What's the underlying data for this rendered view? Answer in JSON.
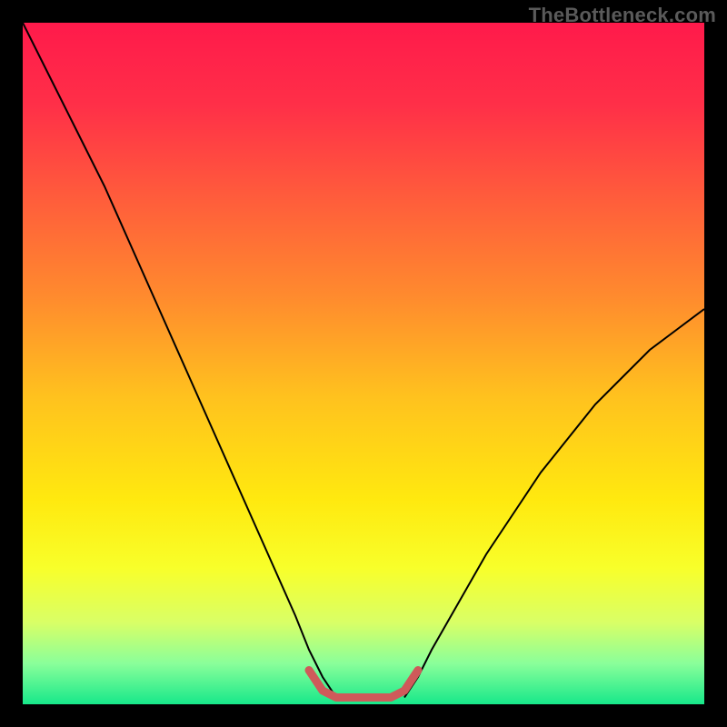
{
  "watermark": "TheBottleneck.com",
  "chart_data": {
    "type": "line",
    "title": "",
    "xlabel": "",
    "ylabel": "",
    "xlim": [
      0,
      100
    ],
    "ylim": [
      0,
      100
    ],
    "grid": false,
    "legend": false,
    "gradient_stops": [
      {
        "offset": 0.0,
        "color": "#ff1a4b"
      },
      {
        "offset": 0.12,
        "color": "#ff2f48"
      },
      {
        "offset": 0.25,
        "color": "#ff5a3c"
      },
      {
        "offset": 0.4,
        "color": "#ff8a2e"
      },
      {
        "offset": 0.55,
        "color": "#ffc21e"
      },
      {
        "offset": 0.7,
        "color": "#ffe90f"
      },
      {
        "offset": 0.8,
        "color": "#f8ff2a"
      },
      {
        "offset": 0.88,
        "color": "#d9ff66"
      },
      {
        "offset": 0.94,
        "color": "#8aff9a"
      },
      {
        "offset": 1.0,
        "color": "#17e88a"
      }
    ],
    "series": [
      {
        "name": "left-curve",
        "stroke": "#000000",
        "stroke_width": 2,
        "x": [
          0,
          4,
          8,
          12,
          16,
          20,
          24,
          28,
          32,
          36,
          40,
          42,
          44,
          46
        ],
        "y": [
          100,
          92,
          84,
          76,
          67,
          58,
          49,
          40,
          31,
          22,
          13,
          8,
          4,
          1
        ]
      },
      {
        "name": "right-curve",
        "stroke": "#000000",
        "stroke_width": 2,
        "x": [
          56,
          58,
          60,
          64,
          68,
          72,
          76,
          80,
          84,
          88,
          92,
          96,
          100
        ],
        "y": [
          1,
          4,
          8,
          15,
          22,
          28,
          34,
          39,
          44,
          48,
          52,
          55,
          58
        ]
      },
      {
        "name": "flat-bottom-indicator",
        "stroke": "#cf5a5a",
        "stroke_width": 9,
        "linecap": "round",
        "x": [
          42,
          44,
          46,
          48,
          50,
          52,
          54,
          56,
          58
        ],
        "y": [
          5,
          2,
          1,
          1,
          1,
          1,
          1,
          2,
          5
        ]
      }
    ]
  }
}
